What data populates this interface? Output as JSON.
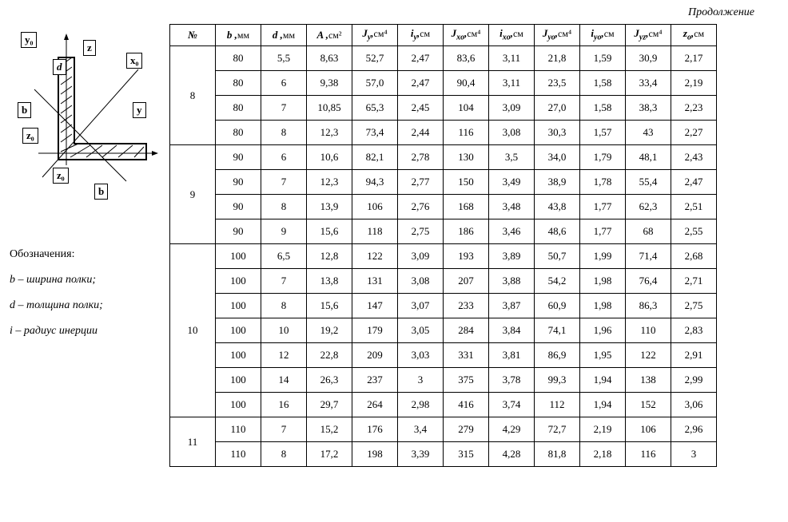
{
  "continuation_text": "Продолжение",
  "diagram_labels": {
    "y0": "y₀",
    "z": "z",
    "x0": "x₀",
    "d": "d",
    "b_left": "b",
    "y": "y",
    "z0_left": "z₀",
    "z0_bottom": "z₀",
    "b_bottom": "b"
  },
  "legend": {
    "l1": "Обозначения:",
    "l2": "b – ширина полки;",
    "l3": "d – толщина полки;",
    "l4": "i – радиус инерции"
  },
  "headers": {
    "num": "№",
    "b_sym": "b",
    "b_unit": "мм",
    "d_sym": "d",
    "d_unit": "мм",
    "A_sym": "A",
    "A_unit": "см²",
    "Jy_sym": "Jy",
    "Jy_unit": "см⁴",
    "iy_sym": "iy",
    "iy_unit": "см",
    "Jxo_sym": "Jxo",
    "Jxo_unit": "см⁴",
    "ixo_sym": "ixo",
    "ixo_unit": "см",
    "Jyo_sym": "Jyo",
    "Jyo_unit": "см⁴",
    "iyo_sym": "iyo",
    "iyo_unit": "см",
    "Jyz_sym": "Jyz",
    "Jyz_unit": "см⁴",
    "zo_sym": "zo",
    "zo_unit": "см"
  },
  "groups": [
    {
      "num": "8",
      "rows": [
        {
          "b": "80",
          "d": "5,5",
          "A": "8,63",
          "Jy": "52,7",
          "iy": "2,47",
          "Jxo": "83,6",
          "ixo": "3,11",
          "Jyo": "21,8",
          "iyo": "1,59",
          "Jyz": "30,9",
          "zo": "2,17"
        },
        {
          "b": "80",
          "d": "6",
          "A": "9,38",
          "Jy": "57,0",
          "iy": "2,47",
          "Jxo": "90,4",
          "ixo": "3,11",
          "Jyo": "23,5",
          "iyo": "1,58",
          "Jyz": "33,4",
          "zo": "2,19"
        },
        {
          "b": "80",
          "d": "7",
          "A": "10,85",
          "Jy": "65,3",
          "iy": "2,45",
          "Jxo": "104",
          "ixo": "3,09",
          "Jyo": "27,0",
          "iyo": "1,58",
          "Jyz": "38,3",
          "zo": "2,23"
        },
        {
          "b": "80",
          "d": "8",
          "A": "12,3",
          "Jy": "73,4",
          "iy": "2,44",
          "Jxo": "116",
          "ixo": "3,08",
          "Jyo": "30,3",
          "iyo": "1,57",
          "Jyz": "43",
          "zo": "2,27"
        }
      ]
    },
    {
      "num": "9",
      "rows": [
        {
          "b": "90",
          "d": "6",
          "A": "10,6",
          "Jy": "82,1",
          "iy": "2,78",
          "Jxo": "130",
          "ixo": "3,5",
          "Jyo": "34,0",
          "iyo": "1,79",
          "Jyz": "48,1",
          "zo": "2,43"
        },
        {
          "b": "90",
          "d": "7",
          "A": "12,3",
          "Jy": "94,3",
          "iy": "2,77",
          "Jxo": "150",
          "ixo": "3,49",
          "Jyo": "38,9",
          "iyo": "1,78",
          "Jyz": "55,4",
          "zo": "2,47"
        },
        {
          "b": "90",
          "d": "8",
          "A": "13,9",
          "Jy": "106",
          "iy": "2,76",
          "Jxo": "168",
          "ixo": "3,48",
          "Jyo": "43,8",
          "iyo": "1,77",
          "Jyz": "62,3",
          "zo": "2,51"
        },
        {
          "b": "90",
          "d": "9",
          "A": "15,6",
          "Jy": "118",
          "iy": "2,75",
          "Jxo": "186",
          "ixo": "3,46",
          "Jyo": "48,6",
          "iyo": "1,77",
          "Jyz": "68",
          "zo": "2,55"
        }
      ]
    },
    {
      "num": "10",
      "rows": [
        {
          "b": "100",
          "d": "6,5",
          "A": "12,8",
          "Jy": "122",
          "iy": "3,09",
          "Jxo": "193",
          "ixo": "3,89",
          "Jyo": "50,7",
          "iyo": "1,99",
          "Jyz": "71,4",
          "zo": "2,68"
        },
        {
          "b": "100",
          "d": "7",
          "A": "13,8",
          "Jy": "131",
          "iy": "3,08",
          "Jxo": "207",
          "ixo": "3,88",
          "Jyo": "54,2",
          "iyo": "1,98",
          "Jyz": "76,4",
          "zo": "2,71"
        },
        {
          "b": "100",
          "d": "8",
          "A": "15,6",
          "Jy": "147",
          "iy": "3,07",
          "Jxo": "233",
          "ixo": "3,87",
          "Jyo": "60,9",
          "iyo": "1,98",
          "Jyz": "86,3",
          "zo": "2,75"
        },
        {
          "b": "100",
          "d": "10",
          "A": "19,2",
          "Jy": "179",
          "iy": "3,05",
          "Jxo": "284",
          "ixo": "3,84",
          "Jyo": "74,1",
          "iyo": "1,96",
          "Jyz": "110",
          "zo": "2,83"
        },
        {
          "b": "100",
          "d": "12",
          "A": "22,8",
          "Jy": "209",
          "iy": "3,03",
          "Jxo": "331",
          "ixo": "3,81",
          "Jyo": "86,9",
          "iyo": "1,95",
          "Jyz": "122",
          "zo": "2,91"
        },
        {
          "b": "100",
          "d": "14",
          "A": "26,3",
          "Jy": "237",
          "iy": "3",
          "Jxo": "375",
          "ixo": "3,78",
          "Jyo": "99,3",
          "iyo": "1,94",
          "Jyz": "138",
          "zo": "2,99"
        },
        {
          "b": "100",
          "d": "16",
          "A": "29,7",
          "Jy": "264",
          "iy": "2,98",
          "Jxo": "416",
          "ixo": "3,74",
          "Jyo": "112",
          "iyo": "1,94",
          "Jyz": "152",
          "zo": "3,06"
        }
      ]
    },
    {
      "num": "11",
      "rows": [
        {
          "b": "110",
          "d": "7",
          "A": "15,2",
          "Jy": "176",
          "iy": "3,4",
          "Jxo": "279",
          "ixo": "4,29",
          "Jyo": "72,7",
          "iyo": "2,19",
          "Jyz": "106",
          "zo": "2,96"
        },
        {
          "b": "110",
          "d": "8",
          "A": "17,2",
          "Jy": "198",
          "iy": "3,39",
          "Jxo": "315",
          "ixo": "4,28",
          "Jyo": "81,8",
          "iyo": "2,18",
          "Jyz": "116",
          "zo": "3"
        }
      ]
    }
  ]
}
